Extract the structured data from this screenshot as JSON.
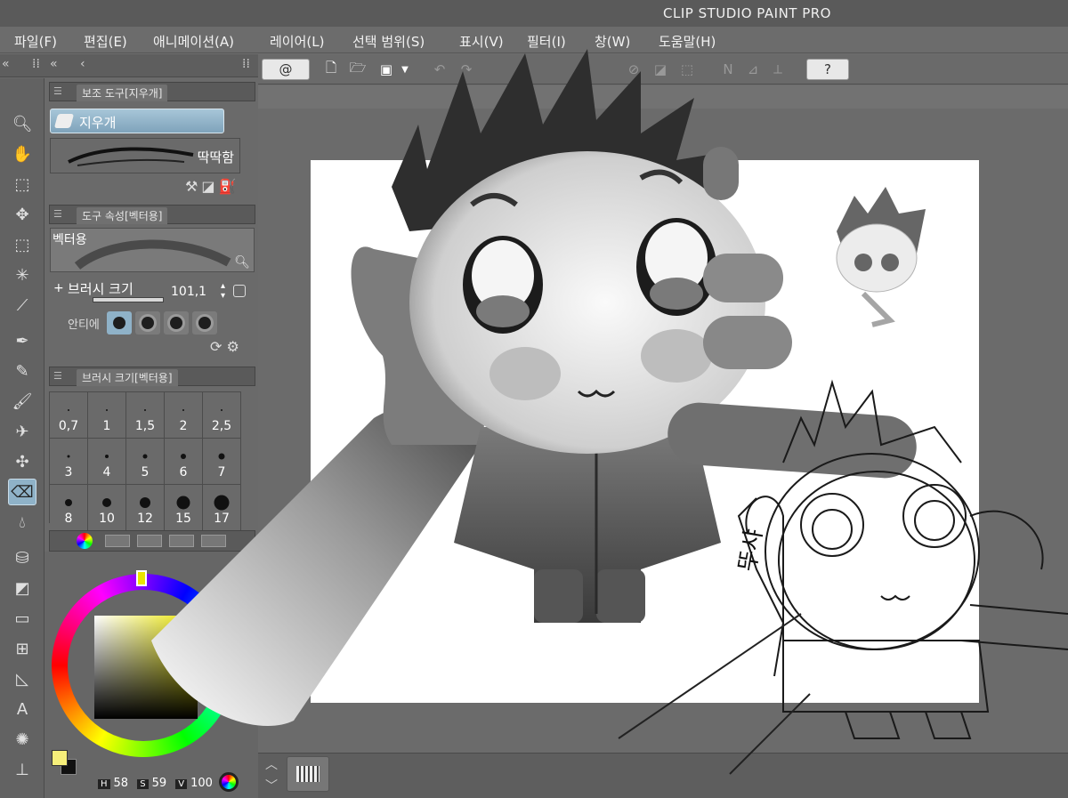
{
  "app": {
    "title": "CLIP STUDIO PAINT PRO"
  },
  "menu": [
    "파일(F)",
    "편집(E)",
    "애니메이션(A)",
    "레이어(L)",
    "선택 범위(S)",
    "표시(V)",
    "필터(I)",
    "창(W)",
    "도움말(H)"
  ],
  "subtool_panel": {
    "tab": "보조 도구[지우개]",
    "selected": "지우개",
    "brush_name": "딱딱함"
  },
  "tool_property_panel": {
    "tab": "도구 속성[벡터용]",
    "preset_name": "벡터용",
    "brush_size_label": "브러시 크기",
    "brush_size_value": "101,1",
    "antialias_label": "안티에"
  },
  "brush_size_panel": {
    "tab": "브러시 크기[벡터용]",
    "sizes": [
      "0,7",
      "1",
      "1,5",
      "2",
      "2,5",
      "3",
      "4",
      "5",
      "6",
      "7",
      "8",
      "10",
      "12",
      "15",
      "17"
    ]
  },
  "color": {
    "h": "58",
    "s": "59",
    "v": "100",
    "fg": "#f6ef7a",
    "bg": "#111111"
  },
  "toolbar": {
    "help_icon": "question-icon"
  },
  "artwork_text": "뚜샤"
}
